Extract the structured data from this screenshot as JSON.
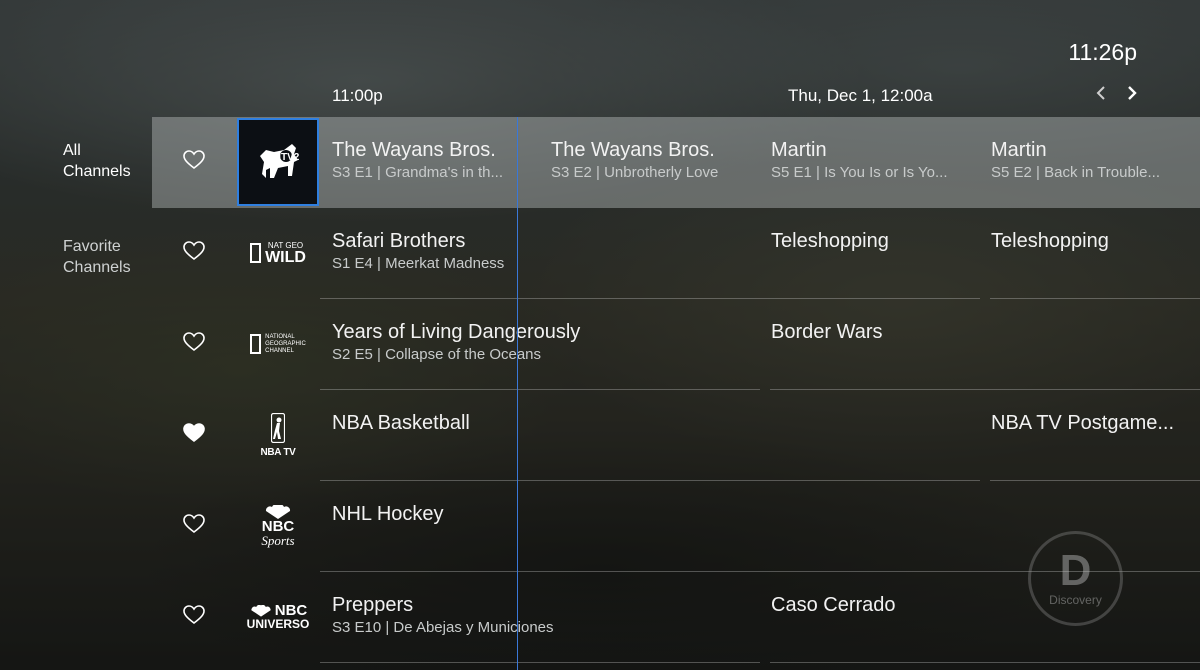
{
  "clock": "11:26p",
  "timeline": {
    "slot1": "11:00p",
    "slot2": "Thu, Dec 1, 12:00a",
    "prev_icon": "chevron-left-icon",
    "next_icon": "chevron-right-icon"
  },
  "sidebar": {
    "all": [
      "All",
      "Channels"
    ],
    "favorite": [
      "Favorite",
      "Channels"
    ]
  },
  "channels": [
    {
      "logo": "MTV2",
      "favorite": false,
      "programs": [
        {
          "title": "The Wayans Bros.",
          "sub": "S3 E1  |  Grandma's in th..."
        },
        {
          "title": "The Wayans Bros.",
          "sub": "S3 E2  |  Unbrotherly Love"
        },
        {
          "title": "Martin",
          "sub": "S5 E1  |  Is You Is or Is Yo..."
        },
        {
          "title": "Martin",
          "sub": "S5 E2  |  Back in Trouble..."
        }
      ]
    },
    {
      "logo": [
        "NAT GEO",
        "WILD"
      ],
      "favorite": false,
      "programs": [
        {
          "title": "Safari Brothers",
          "sub": "S1 E4  |  Meerkat Madness"
        },
        {
          "title": "Teleshopping",
          "sub": ""
        },
        {
          "title": "Teleshopping",
          "sub": ""
        }
      ]
    },
    {
      "logo": [
        "NATIONAL",
        "GEOGRAPHIC",
        "CHANNEL"
      ],
      "favorite": false,
      "programs": [
        {
          "title": "Years of Living Dangerously",
          "sub": "S2 E5  |  Collapse of the Oceans"
        },
        {
          "title": "Border Wars",
          "sub": ""
        }
      ]
    },
    {
      "logo": "NBA TV",
      "favorite": true,
      "programs": [
        {
          "title": "NBA Basketball",
          "sub": ""
        },
        {
          "title": "NBA TV Postgame...",
          "sub": ""
        }
      ]
    },
    {
      "logo": [
        "NBC",
        "Sports"
      ],
      "favorite": false,
      "programs": [
        {
          "title": "NHL Hockey",
          "sub": ""
        }
      ]
    },
    {
      "logo": [
        "NBC",
        "UNIVERSO"
      ],
      "favorite": false,
      "programs": [
        {
          "title": "Preppers",
          "sub": "S3 E10  |  De Abejas y Municiones"
        },
        {
          "title": "Caso Cerrado",
          "sub": ""
        }
      ]
    }
  ],
  "watermark": {
    "letter": "D",
    "word": "Discovery"
  },
  "colors": {
    "accent": "#2f7fe0",
    "nowline": "#3a78d8"
  }
}
